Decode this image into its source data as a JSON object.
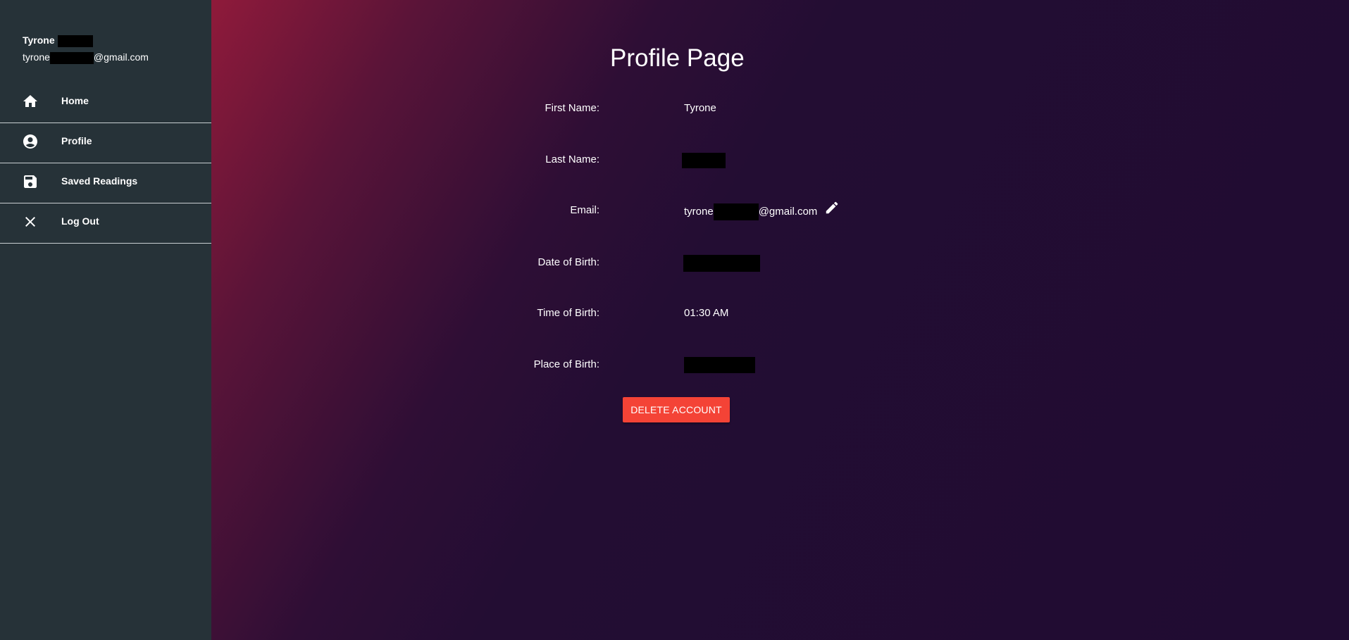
{
  "sidebar": {
    "user": {
      "name": "Tyrone",
      "email_prefix": "tyrone",
      "email_suffix": "@gmail.com"
    },
    "items": [
      {
        "label": "Home",
        "icon": "home-icon"
      },
      {
        "label": "Profile",
        "icon": "account-circle-icon"
      },
      {
        "label": "Saved Readings",
        "icon": "save-icon"
      },
      {
        "label": "Log Out",
        "icon": "close-icon"
      }
    ]
  },
  "main": {
    "title": "Profile Page",
    "fields": {
      "first_name": {
        "label": "First Name:",
        "value": "Tyrone"
      },
      "last_name": {
        "label": "Last Name:"
      },
      "email": {
        "label": "Email:",
        "value_prefix": "tyrone",
        "value_suffix": "@gmail.com"
      },
      "dob": {
        "label": "Date of Birth:"
      },
      "tob": {
        "label": "Time of Birth:",
        "value": "01:30 AM"
      },
      "pob": {
        "label": "Place of Birth:"
      }
    },
    "delete_label": "DELETE ACCOUNT"
  },
  "colors": {
    "sidebar_bg": "#263238",
    "main_bg": "#200c32",
    "gradient_accent": "#8f1a3a",
    "danger": "#f44336"
  }
}
